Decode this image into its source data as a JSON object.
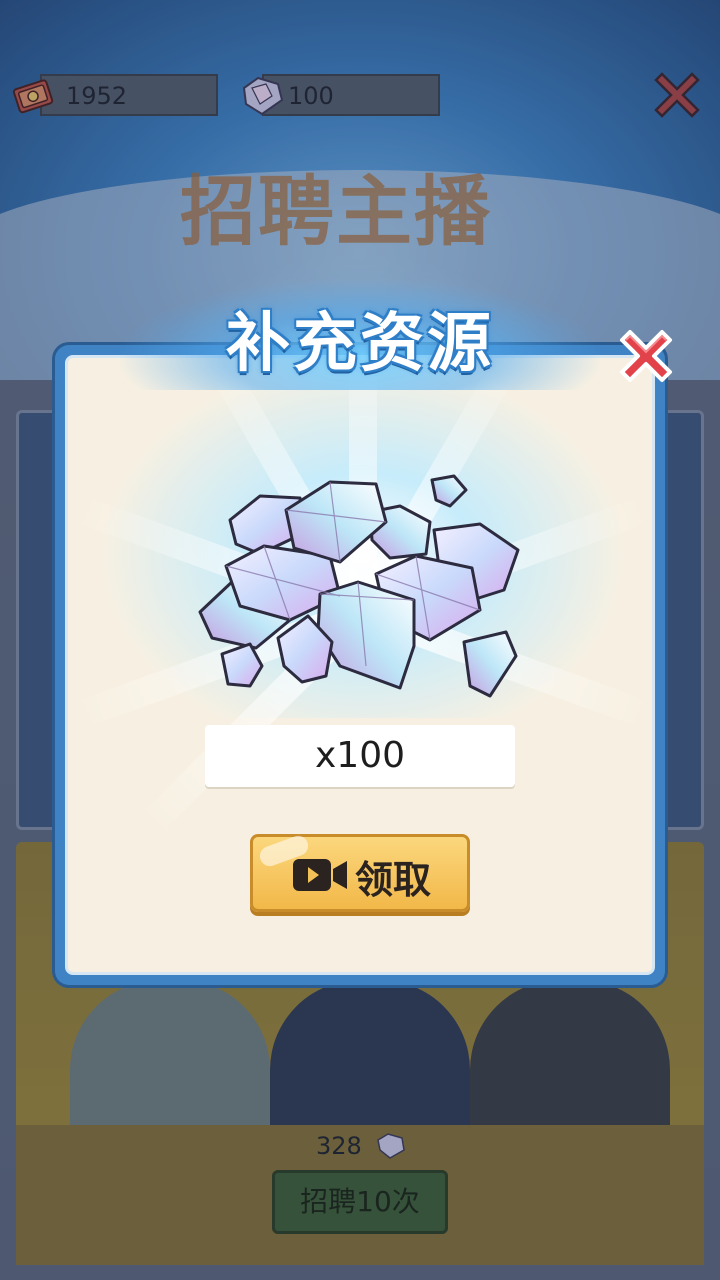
{
  "top_bar": {
    "money_value": "1952",
    "gem_value": "100"
  },
  "background": {
    "title": "招聘主播",
    "recruit_cost": "328",
    "recruit_button_label": "招聘10次"
  },
  "dialog": {
    "title": "补充资源",
    "reward_amount": "x100",
    "claim_button_label": "领取"
  },
  "colors": {
    "dialog_border": "#3f83c4",
    "dialog_background": "#f7f0e2",
    "claim_button": "#f2b849",
    "close_red": "#e2434b"
  }
}
